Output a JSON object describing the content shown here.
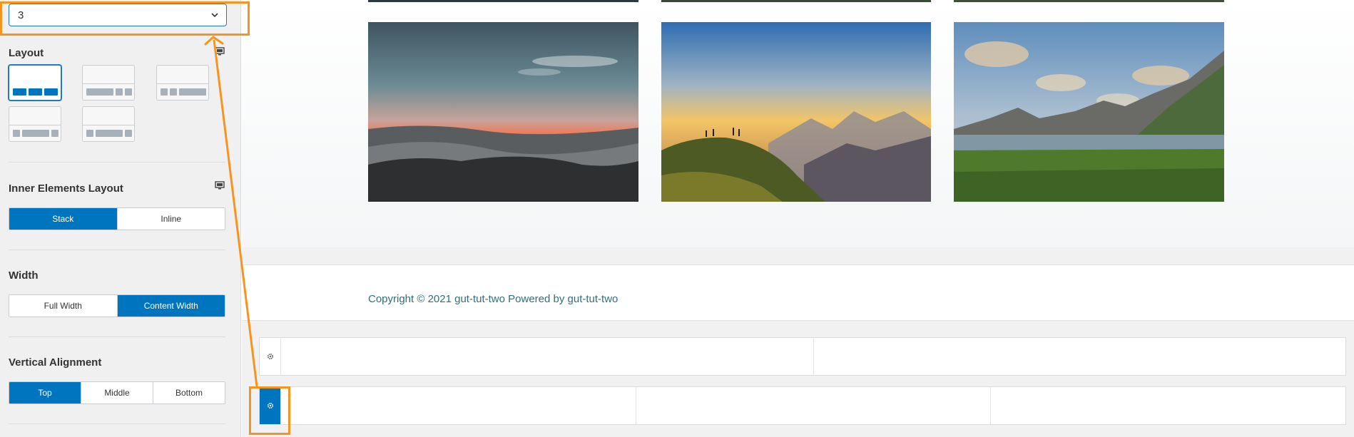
{
  "sidebar": {
    "columns_select": {
      "value": "3"
    },
    "layout": {
      "title": "Layout",
      "device_icon": "desktop-icon",
      "options": [
        {
          "name": "equal-thirds",
          "active": true
        },
        {
          "name": "wide-left",
          "active": false
        },
        {
          "name": "wide-right",
          "active": false
        },
        {
          "name": "wide-center",
          "active": false
        },
        {
          "name": "wide-center-alt",
          "active": false
        }
      ]
    },
    "inner_layout": {
      "title": "Inner Elements Layout",
      "device_icon": "desktop-icon",
      "options": [
        "Stack",
        "Inline"
      ],
      "selected": "Stack"
    },
    "width": {
      "title": "Width",
      "options": [
        "Full Width",
        "Content Width"
      ],
      "selected": "Content Width"
    },
    "vertical_alignment": {
      "title": "Vertical Alignment",
      "options": [
        "Top",
        "Middle",
        "Bottom"
      ],
      "selected": "Top"
    }
  },
  "preview": {
    "images": [
      {
        "name": "mountain-sunrise-fog",
        "alt": "sunrise over misty valley"
      },
      {
        "name": "hikers-on-hilltop",
        "alt": "hikers at sunset on hill"
      },
      {
        "name": "fjord-lake-mountains",
        "alt": "lake with mountains"
      }
    ],
    "footer": {
      "copyright": "Copyright © 2021 gut-tut-two Powered by gut-tut-two"
    },
    "rows": [
      {
        "columns": 2,
        "active": false
      },
      {
        "columns": 3,
        "active": true
      }
    ]
  },
  "annotations": {
    "color": "#f7941d"
  },
  "colors": {
    "accent": "#0075bf",
    "footer_text": "#2f6f7c",
    "highlight": "#f7941d"
  }
}
